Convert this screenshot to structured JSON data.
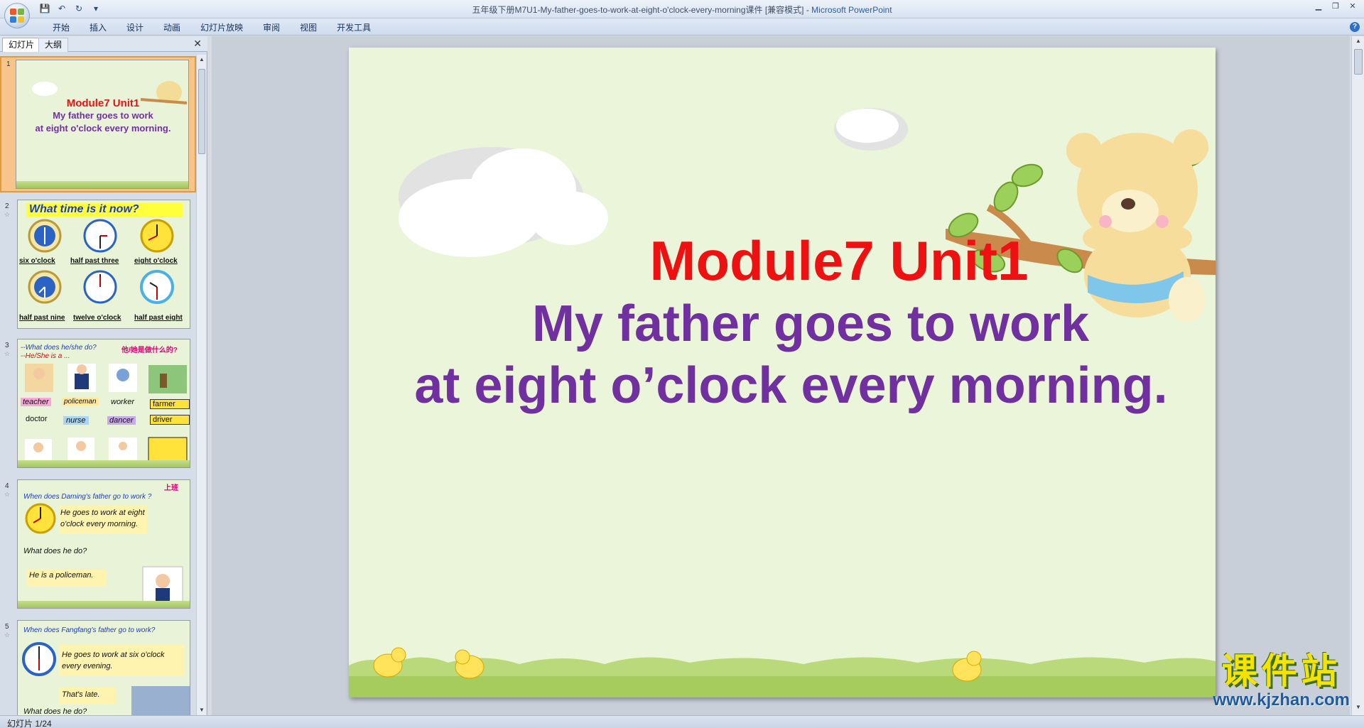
{
  "window": {
    "title": "五年级下册M7U1-My-father-goes-to-work-at-eight-o'clock-every-morning课件 [兼容模式] - ",
    "app_name": "Microsoft PowerPoint"
  },
  "qat": {
    "save_icon": "💾",
    "undo_icon": "↶",
    "redo_icon": "↻",
    "customize_icon": "▾"
  },
  "ribbon": {
    "tabs": [
      "开始",
      "插入",
      "设计",
      "动画",
      "幻灯片放映",
      "审阅",
      "视图",
      "开发工具"
    ],
    "help": "?"
  },
  "panel": {
    "tab_slides": "幻灯片",
    "tab_outline": "大纲",
    "close": "✕"
  },
  "thumbnails": [
    {
      "num": "1",
      "line1": "Module7 Unit1",
      "line2": "My father goes to work",
      "line3": "at eight o'clock every morning."
    },
    {
      "num": "2",
      "heading": "What time is it now?",
      "labels": [
        "six o'clock",
        "half past three",
        "eight o'clock",
        "half past nine",
        "twelve o'clock",
        "half past eight"
      ]
    },
    {
      "num": "3",
      "q1": "--What does he/she do?",
      "q1_cn": "他/她是做什么的?",
      "q2": "--He/She is a ...",
      "jobs": [
        "teacher",
        "policeman",
        "worker",
        "farmer",
        "doctor",
        "nurse",
        "dancer",
        "driver"
      ]
    },
    {
      "num": "4",
      "tag": "上班",
      "q": "When does Daming's father go to work ?",
      "a": "He goes to work at eight o'clock every morning.",
      "q2": "What does he do?",
      "a2": "He is a policeman."
    },
    {
      "num": "5",
      "q": "When does Fangfang's father go to work?",
      "a": "He goes to work at six o'clock every evening.",
      "b": "That's late.",
      "c": "What does he do?"
    }
  ],
  "slide": {
    "title": "Module7 Unit1",
    "line2": "My father goes to work",
    "line3": "at eight o’clock every morning."
  },
  "status": {
    "slide_pos": "幻灯片 1/24"
  },
  "watermark": {
    "cn": "课件站",
    "url": "www.kjzhan.com"
  },
  "colors": {
    "title_red": "#ee1111",
    "subtitle_purple": "#7030a0",
    "slide_bg": "#ebf5d9"
  }
}
